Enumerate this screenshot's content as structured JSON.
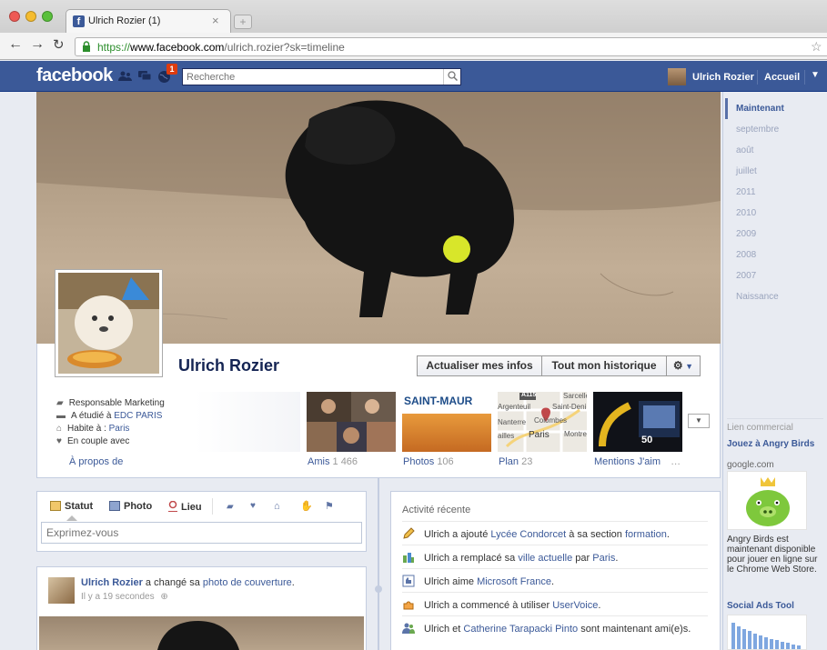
{
  "browser": {
    "tab_title": "Ulrich Rozier (1)",
    "url_scheme": "https://",
    "url_host": "www.facebook.com",
    "url_path": "/ulrich.rozier?sk=timeline"
  },
  "fb": {
    "logo": "facebook",
    "notif_count": "1",
    "search_placeholder": "Recherche",
    "user_name": "Ulrich Rozier",
    "home": "Accueil"
  },
  "profile": {
    "name": "Ulrich Rozier",
    "update_info": "Actualiser mes infos",
    "activity_log": "Tout mon historique",
    "about": [
      {
        "text": "Responsable Marketing",
        "link": ""
      },
      {
        "text": "A étudié à ",
        "link": "EDC PARIS"
      },
      {
        "text": "Habite à : ",
        "link": "Paris"
      },
      {
        "text": "En couple avec",
        "link": ""
      }
    ],
    "about_label": "À propos de",
    "sections": [
      {
        "label": "Amis",
        "count": "1 466"
      },
      {
        "label": "Photos",
        "count": "106"
      },
      {
        "label": "Plan",
        "count": "23"
      },
      {
        "label": "Mentions J'aim",
        "count": "…"
      }
    ],
    "photos_thumb_text": "SAINT-MAUR",
    "map_labels": [
      "A115",
      "Sarcelles",
      "Argenteuil",
      "Saint-Deni",
      "Nanterre",
      "Colombes",
      "Paris",
      "Montre",
      "ailles"
    ],
    "likes_badge": "50"
  },
  "timeline": [
    "Maintenant",
    "septembre",
    "août",
    "juillet",
    "2011",
    "2010",
    "2009",
    "2008",
    "2007",
    "Naissance"
  ],
  "composer": {
    "tabs": [
      "Statut",
      "Photo",
      "Lieu"
    ],
    "placeholder": "Exprimez-vous"
  },
  "story": {
    "author": "Ulrich Rozier",
    "verb": " a changé sa ",
    "object": "photo de couverture",
    "time": "Il y a 19 secondes"
  },
  "activity": {
    "title": "Activité récente",
    "items": [
      {
        "a": "Ulrich a ajouté ",
        "l1": "Lycée Condorcet",
        "b": " à sa section ",
        "l2": "formation",
        "c": "."
      },
      {
        "a": "Ulrich a remplacé sa ",
        "l1": "ville actuelle",
        "b": " par ",
        "l2": "Paris",
        "c": "."
      },
      {
        "a": "Ulrich aime ",
        "l1": "Microsoft France",
        "b": "",
        "l2": "",
        "c": "."
      },
      {
        "a": "Ulrich a commencé à utiliser ",
        "l1": "UserVoice",
        "b": "",
        "l2": "",
        "c": "."
      },
      {
        "a": "Ulrich et ",
        "l1": "Catherine Tarapacki Pinto",
        "b": " sont maintenant ami(e)s.",
        "l2": "",
        "c": ""
      }
    ]
  },
  "ads": {
    "header": "Lien commercial",
    "ad1_title": "Jouez à Angry Birds",
    "ad1_domain": "google.com",
    "ad1_text": "Angry Birds est maintenant disponible pour jouer en ligne sur le Chrome Web Store.",
    "ad2_title": "Social Ads Tool"
  },
  "colors": {
    "fb_blue": "#3b5998",
    "link": "#3b5998",
    "notif": "#dd3c10"
  }
}
